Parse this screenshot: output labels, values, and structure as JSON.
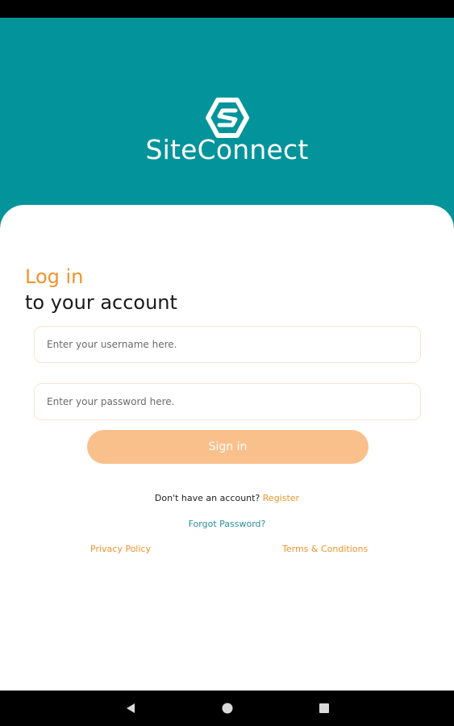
{
  "app": {
    "name": "SiteConnect",
    "logo_icon": "siteconnect-logo-icon",
    "brand_color": "#03949b",
    "accent_color": "#f0932b"
  },
  "login": {
    "title_accent": "Log in",
    "title_main": "to your account",
    "username_placeholder": "Enter your username here.",
    "password_placeholder": "Enter your password here.",
    "signin_label": "Sign in",
    "no_account_text": "Don't have an account? ",
    "register_label": "Register",
    "forgot_password_label": "Forgot Password?",
    "privacy_label": "Privacy Policy",
    "terms_label": "Terms & Conditions"
  },
  "nav": {
    "back_icon": "back-icon",
    "home_icon": "home-icon",
    "recents_icon": "recents-icon"
  }
}
